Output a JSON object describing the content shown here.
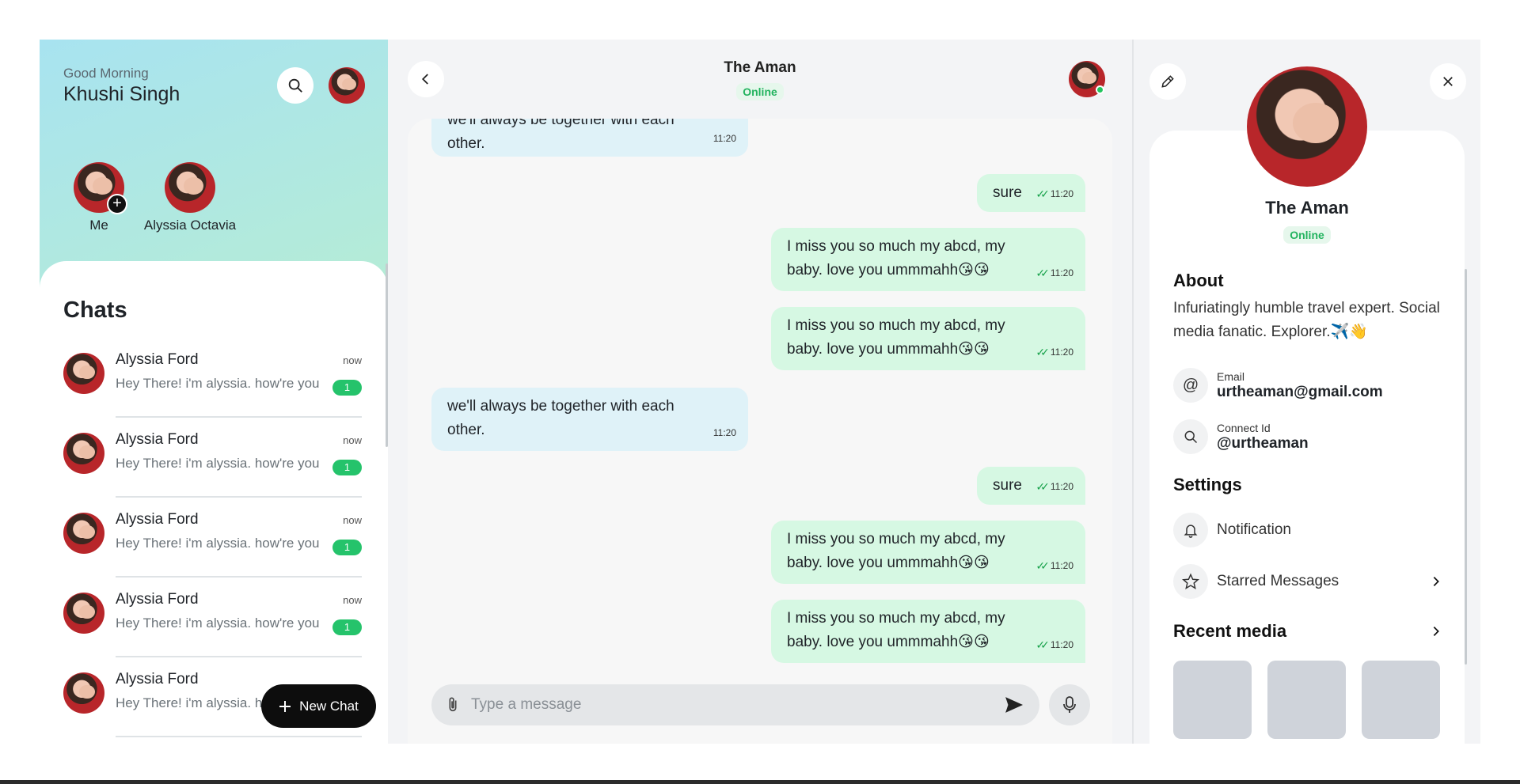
{
  "sidebar": {
    "greeting": "Good Morning",
    "user_name": "Khushi Singh",
    "stories": [
      {
        "label": "Me"
      },
      {
        "label": "Alyssia Octavia"
      }
    ],
    "chats_title": "Chats",
    "chats": [
      {
        "name": "Alyssia Ford",
        "time": "now",
        "preview": "Hey There! i'm alyssia. how're you",
        "unread": "1"
      },
      {
        "name": "Alyssia Ford",
        "time": "now",
        "preview": "Hey There! i'm alyssia. how're you",
        "unread": "1"
      },
      {
        "name": "Alyssia Ford",
        "time": "now",
        "preview": "Hey There! i'm alyssia. how're you",
        "unread": "1"
      },
      {
        "name": "Alyssia Ford",
        "time": "now",
        "preview": "Hey There! i'm alyssia. how're you",
        "unread": "1"
      },
      {
        "name": "Alyssia Ford",
        "time": "now",
        "preview": "Hey There! i'm alyssia. h",
        "unread": ""
      }
    ],
    "new_chat_label": "New Chat"
  },
  "chat": {
    "contact_name": "The Aman",
    "status": "Online",
    "messages": [
      {
        "dir": "in",
        "text": "we'll always be together with each other.",
        "time": "11:20"
      },
      {
        "dir": "out",
        "text": "sure",
        "time": "11:20"
      },
      {
        "dir": "out",
        "text": "I miss you so much my abcd, my baby. love you ummmahh😘😘",
        "time": "11:20"
      },
      {
        "dir": "out",
        "text": "I miss you so much my abcd, my baby. love you ummmahh😘😘",
        "time": "11:20"
      },
      {
        "dir": "in",
        "text": "we'll always be together with each other.",
        "time": "11:20"
      },
      {
        "dir": "out",
        "text": "sure",
        "time": "11:20"
      },
      {
        "dir": "out",
        "text": "I miss you so much my abcd, my baby. love you ummmahh😘😘",
        "time": "11:20"
      },
      {
        "dir": "out",
        "text": "I miss you so much my abcd, my baby. love you ummmahh😘😘",
        "time": "11:20"
      }
    ],
    "composer_placeholder": "Type a message"
  },
  "profile": {
    "name": "The Aman",
    "status": "Online",
    "about_title": "About",
    "about_text": "Infuriatingly humble travel expert. Social media fanatic. Explorer.✈️👋",
    "email_label": "Email",
    "email_value": "urtheaman@gmail.com",
    "connect_label": "Connect Id",
    "connect_value": "@urtheaman",
    "settings_title": "Settings",
    "notification_label": "Notification",
    "starred_label": "Starred Messages",
    "recent_media_title": "Recent media"
  },
  "colors": {
    "accent_green": "#25c36b",
    "incoming_bubble": "#dff2f8",
    "outgoing_bubble": "#d6f8e3"
  }
}
